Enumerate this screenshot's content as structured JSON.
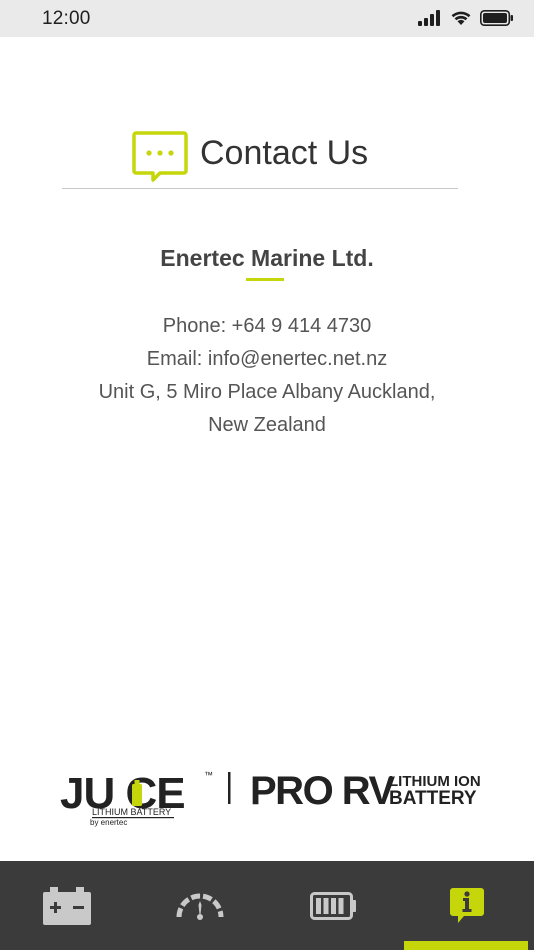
{
  "status_bar": {
    "time": "12:00",
    "icons": [
      "signal-icon",
      "wifi-icon",
      "battery-icon"
    ]
  },
  "header": {
    "title": "Contact Us",
    "icon": "chat-bubble-icon"
  },
  "company": {
    "name": "Enertec Marine Ltd.",
    "lines": [
      "Phone: +64 9 414 4730",
      "Email: info@enertec.net.nz",
      "Unit G, 5 Miro Place Albany Auckland,",
      "New Zealand"
    ]
  },
  "brand": {
    "juice": "JU CE",
    "tm": "™",
    "juice_sub": "LITHIUM BATTERY",
    "by": "by enertec",
    "pro_rv": "PRO RV",
    "lithium_ion": "LITHIUM ION",
    "battery": "BATTERY"
  },
  "bottom_nav": {
    "items": [
      {
        "icon": "car-battery-icon",
        "active": false
      },
      {
        "icon": "gauge-icon",
        "active": false
      },
      {
        "icon": "battery-level-icon",
        "active": false
      },
      {
        "icon": "info-icon",
        "active": true
      }
    ]
  },
  "colors": {
    "accent": "#c5d60a",
    "nav_bg": "#3b3b3b",
    "nav_icon": "#c9c9c9",
    "status_bg": "#eaeaea",
    "text": "#555555"
  }
}
